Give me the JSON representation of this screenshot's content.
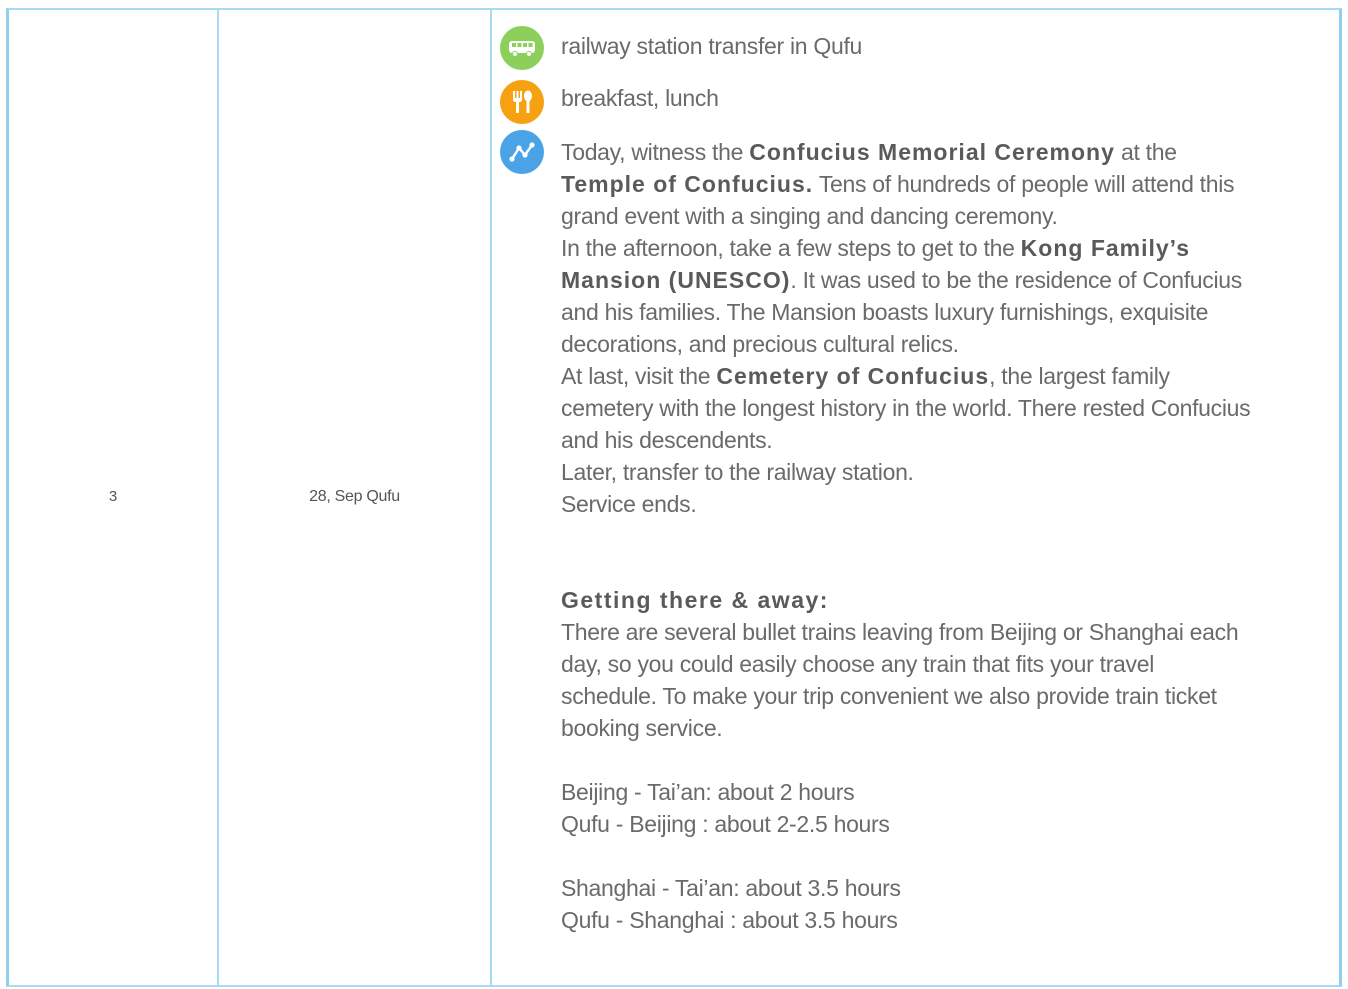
{
  "row": {
    "day": "3",
    "date": "28, Sep Qufu",
    "transfer": {
      "icon": "bus-icon",
      "text": "railway station transfer in Qufu"
    },
    "meals": {
      "icon": "fork-spoon-icon",
      "text": "breakfast, lunch"
    },
    "itinerary": {
      "icon": "route-icon",
      "p1_pre": "Today, witness the ",
      "p1_b1": "Confucius Memorial Ceremony",
      "p1_mid": " at the ",
      "p1_b2": "Temple of Confucius.",
      "p1_post": " Tens of hundreds of people will attend this grand event with a singing and dancing ceremony.",
      "p2_pre": "In the afternoon, take a few steps to get to the ",
      "p2_b": "Kong Family’s Mansion (UNESCO)",
      "p2_post": ". It was used to be the residence of Confucius and his families. The Mansion boasts luxury furnishings, exquisite decorations, and precious cultural relics.",
      "p3_pre": "At last, visit the ",
      "p3_b": "Cemetery of Confucius",
      "p3_post": ", the largest family cemetery with the longest history in the world. There rested Confucius and his descendents.",
      "p4": "Later, transfer to the railway station.",
      "p5": "Service ends.",
      "getting_title": "Getting there & away:",
      "getting_text": "There are several bullet trains leaving from Beijing or Shanghai each day, so you could easily choose any train that fits your travel schedule. To make your trip convenient we also provide train ticket booking service.",
      "route1": "Beijing - Tai’an: about 2 hours",
      "route2": "Qufu - Beijing : about 2-2.5 hours",
      "route3": "Shanghai - Tai’an: about 3.5 hours",
      "route4": "Qufu - Shanghai : about 3.5 hours"
    }
  },
  "colors": {
    "border": "#a8dbf2",
    "bus_icon": "#8ccf5a",
    "food_icon": "#f6a112",
    "route_icon": "#4aa3e6"
  }
}
